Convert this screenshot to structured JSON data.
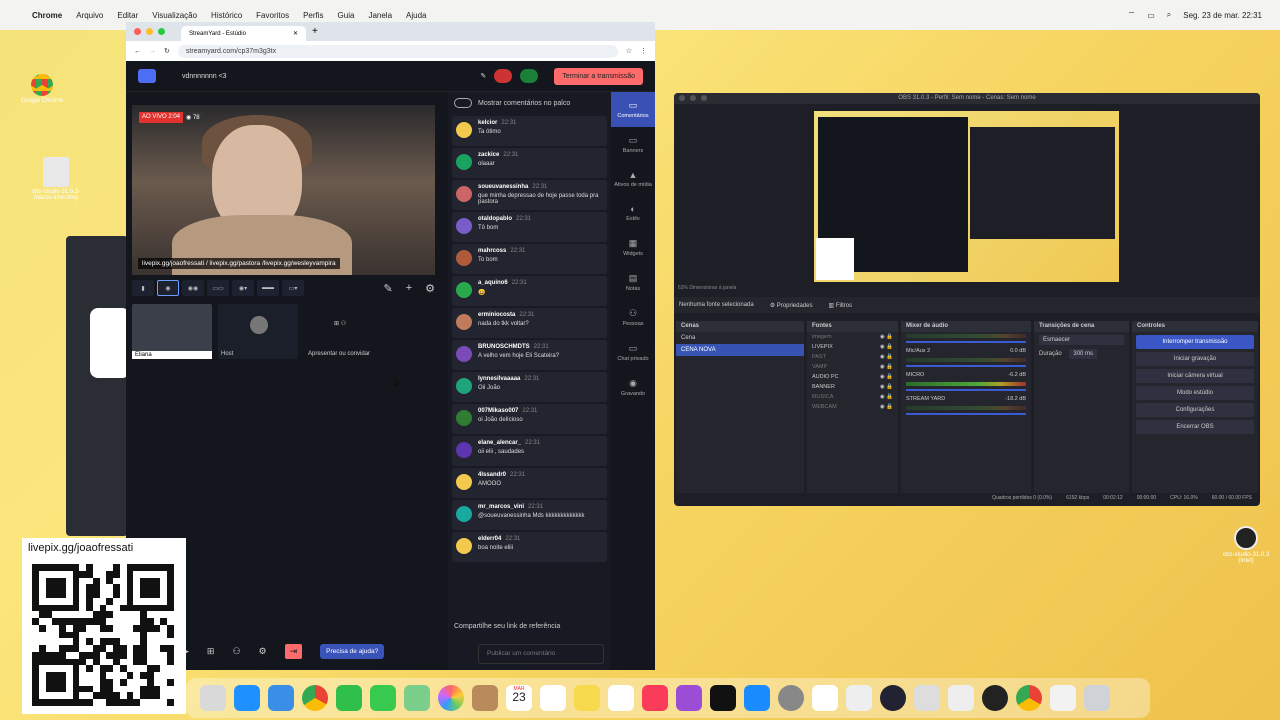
{
  "menubar": {
    "app": "Chrome",
    "items": [
      "Arquivo",
      "Editar",
      "Visualização",
      "Histórico",
      "Favoritos",
      "Perfis",
      "Guia",
      "Janela",
      "Ajuda"
    ],
    "clock": "Seg. 23 de mar.  22:31"
  },
  "desktop": {
    "icon1": "Google Chrome",
    "icon2": "obs-studio-31.0.3-macos-intel.dmg",
    "icon3": "obs-studio-31.0.3 (Intel)"
  },
  "browser": {
    "tab_title": "StreamYard - Estúdio",
    "url": "streamyard.com/cp37m3g3tx"
  },
  "studio": {
    "name": "vdnnnnnnn <3",
    "end_button": "Terminar a transmissão",
    "live_label": "AO VIVO 2:04",
    "viewers": "78",
    "caption": "livepix.gg/joaofressati / livepix.gg/pastora /livepix.gg/wesleyvampira",
    "participants": [
      {
        "name": "Eliana"
      },
      {
        "name": "Host"
      },
      {
        "name": "Apresentar ou convidar"
      }
    ],
    "help": "Precisa de ajuda?"
  },
  "chat": {
    "toggle_label": "Mostrar comentários no palco",
    "share": "Compartilhe seu link de referência",
    "placeholder": "Publicar um comentário",
    "messages": [
      {
        "user": "kelcior",
        "time": "22:31",
        "text": "Ta ótimo",
        "color": "#f2c94c"
      },
      {
        "user": "zackice",
        "time": "22:31",
        "text": "olaaar",
        "color": "#1aa260"
      },
      {
        "user": "soueuvanessinha",
        "time": "22:31",
        "text": "que minha depressao de hoje passe toda pra pastora",
        "color": "#c66"
      },
      {
        "user": "otaldopablo",
        "time": "22:31",
        "text": "Tô bom",
        "color": "#7a5cc9"
      },
      {
        "user": "mahrcoss",
        "time": "22:31",
        "text": "To bom",
        "color": "#b05a3c"
      },
      {
        "user": "a_aquino6",
        "time": "22:31",
        "text": "😀",
        "color": "#2aa94c"
      },
      {
        "user": "erminiocosta",
        "time": "22:31",
        "text": "nada do tkk voltar?",
        "color": "#c07a5c"
      },
      {
        "user": "BRUNOSCHMDTS",
        "time": "22:31",
        "text": "A velho vem hoje Eli Scateira?",
        "color": "#7a4bb8"
      },
      {
        "user": "lynnesilvaaaaa",
        "time": "22:31",
        "text": "Oii João",
        "color": "#1fa37a"
      },
      {
        "user": "007Mikaso007",
        "time": "22:31",
        "text": "oi João delícioso",
        "color": "#2e7d32"
      },
      {
        "user": "elane_alencar_",
        "time": "22:31",
        "text": "oii elii , saudades",
        "color": "#5e35b1"
      },
      {
        "user": "4lssandr0",
        "time": "22:31",
        "text": "AMOOO",
        "color": "#f2c94c"
      },
      {
        "user": "mr_marcos_vini",
        "time": "22:31",
        "text": "@soueuvanessinha Mds kkkkkkkkkkkkk",
        "color": "#1aa9a0"
      },
      {
        "user": "elderr04",
        "time": "22:31",
        "text": "boa noite eliii",
        "color": "#f2c94c"
      }
    ]
  },
  "sidebar": [
    "Comentários",
    "Banners",
    "Ativos de mídia",
    "Estilo",
    "Widgets",
    "Notas",
    "Pessoas",
    "Chat privado",
    "Gravando"
  ],
  "obs": {
    "title": "OBS 31.0.3 - Perfil: Sem nome - Cenas: Sem nome",
    "zoom": "63%",
    "resize": "Dimensionar à janela",
    "no_source": "Nenhuma fonte selecionada",
    "props": "Propriedades",
    "filters": "Filtros",
    "scenes_title": "Cenas",
    "scenes": [
      "Cena",
      "CENA NOVA"
    ],
    "sources_title": "Fontes",
    "sources": [
      "imagem",
      "LIVEPIX",
      "PAST",
      "VAMP",
      "AUDIO PC",
      "BANNER",
      "MUSICA",
      "WEBCAM"
    ],
    "mixer_title": "Mixer de áudio",
    "mixer": [
      {
        "name": "Mic/Aux 2",
        "db": "0.0 dB"
      },
      {
        "name": "MICRO",
        "db": "-6.2 dB"
      },
      {
        "name": "STREAM YARD",
        "db": "-18.2 dB"
      }
    ],
    "transitions_title": "Transições de cena",
    "transition": "Esmaecer",
    "duration_label": "Duração",
    "duration": "300 ms",
    "controls_title": "Controles",
    "controls": [
      "Interromper transmissão",
      "Iniciar gravação",
      "Iniciar câmera virtual",
      "Modo estúdio",
      "Configurações",
      "Encerrar OBS"
    ],
    "status": [
      "Quadros perdidos 0 (0.0%)",
      "6192 kbps",
      "00:02:12",
      "00:00:00",
      "CPU: 16.0%",
      "60.00 / 60.00 FPS"
    ]
  },
  "qr": {
    "title": "livepix.gg/joaofressati"
  },
  "dock": {
    "date": "23",
    "month": "MAR"
  },
  "colors": {
    "accent": "#3a57c5",
    "end": "#ff6b6b"
  }
}
